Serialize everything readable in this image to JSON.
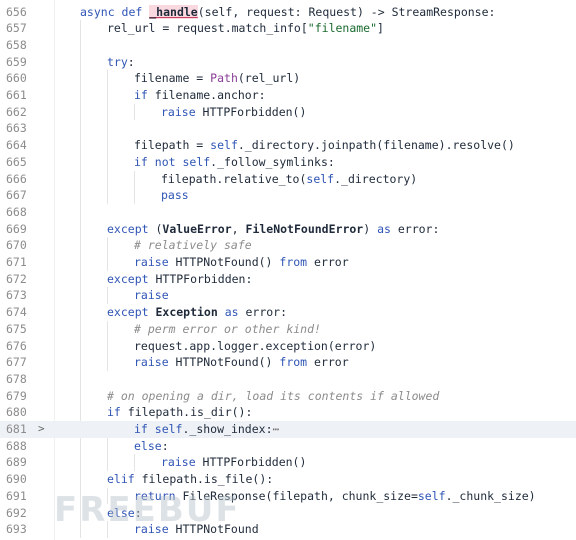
{
  "editor": {
    "current_line": 681,
    "lines": [
      {
        "n": "656",
        "fold": "",
        "indent": 1,
        "parts": [
          [
            "kw",
            "async def "
          ],
          [
            "func-hl",
            "_handle"
          ],
          [
            "par",
            "(self, request: Request) -> StreamResponse:"
          ]
        ]
      },
      {
        "n": "657",
        "fold": "",
        "indent": 2,
        "parts": [
          [
            "par",
            "rel_url = request.match_info["
          ],
          [
            "str",
            "\"filename\""
          ],
          [
            "par",
            "]"
          ]
        ]
      },
      {
        "n": "658",
        "fold": "",
        "indent": 0,
        "parts": []
      },
      {
        "n": "659",
        "fold": "",
        "indent": 2,
        "parts": [
          [
            "kw",
            "try"
          ],
          [
            "par",
            ":"
          ]
        ]
      },
      {
        "n": "660",
        "fold": "",
        "indent": 3,
        "parts": [
          [
            "par",
            "filename = "
          ],
          [
            "fn",
            "Path"
          ],
          [
            "par",
            "(rel_url)"
          ]
        ]
      },
      {
        "n": "661",
        "fold": "",
        "indent": 3,
        "parts": [
          [
            "kw",
            "if "
          ],
          [
            "par",
            "filename.anchor:"
          ]
        ]
      },
      {
        "n": "662",
        "fold": "",
        "indent": 4,
        "parts": [
          [
            "kw",
            "raise "
          ],
          [
            "par",
            "HTTPForbidden()"
          ]
        ]
      },
      {
        "n": "663",
        "fold": "",
        "indent": 0,
        "parts": []
      },
      {
        "n": "664",
        "fold": "",
        "indent": 3,
        "parts": [
          [
            "par",
            "filepath = "
          ],
          [
            "self",
            "self"
          ],
          [
            "par",
            "._directory.joinpath(filename).resolve()"
          ]
        ]
      },
      {
        "n": "665",
        "fold": "",
        "indent": 3,
        "parts": [
          [
            "kw",
            "if not "
          ],
          [
            "self",
            "self"
          ],
          [
            "par",
            "._follow_symlinks:"
          ]
        ]
      },
      {
        "n": "666",
        "fold": "",
        "indent": 4,
        "parts": [
          [
            "par",
            "filepath.relative_to("
          ],
          [
            "self",
            "self"
          ],
          [
            "par",
            "._directory)"
          ]
        ]
      },
      {
        "n": "667",
        "fold": "",
        "indent": 4,
        "parts": [
          [
            "kw",
            "pass"
          ]
        ]
      },
      {
        "n": "668",
        "fold": "",
        "indent": 0,
        "parts": []
      },
      {
        "n": "669",
        "fold": "",
        "indent": 2,
        "parts": [
          [
            "kw",
            "except "
          ],
          [
            "par",
            "("
          ],
          [
            "cls",
            "ValueError"
          ],
          [
            "par",
            ", "
          ],
          [
            "cls",
            "FileNotFoundError"
          ],
          [
            "par",
            ") "
          ],
          [
            "kw",
            "as "
          ],
          [
            "par",
            "error:"
          ]
        ]
      },
      {
        "n": "670",
        "fold": "",
        "indent": 3,
        "parts": [
          [
            "cm",
            "# relatively safe"
          ]
        ]
      },
      {
        "n": "671",
        "fold": "",
        "indent": 3,
        "parts": [
          [
            "kw",
            "raise "
          ],
          [
            "par",
            "HTTPNotFound() "
          ],
          [
            "kw",
            "from "
          ],
          [
            "par",
            "error"
          ]
        ]
      },
      {
        "n": "672",
        "fold": "",
        "indent": 2,
        "parts": [
          [
            "kw",
            "except "
          ],
          [
            "par",
            "HTTPForbidden:"
          ]
        ]
      },
      {
        "n": "673",
        "fold": "",
        "indent": 3,
        "parts": [
          [
            "kw",
            "raise"
          ]
        ]
      },
      {
        "n": "674",
        "fold": "",
        "indent": 2,
        "parts": [
          [
            "kw",
            "except "
          ],
          [
            "cls",
            "Exception"
          ],
          [
            "kw",
            " as "
          ],
          [
            "par",
            "error:"
          ]
        ]
      },
      {
        "n": "675",
        "fold": "",
        "indent": 3,
        "parts": [
          [
            "cm",
            "# perm error or other kind!"
          ]
        ]
      },
      {
        "n": "676",
        "fold": "",
        "indent": 3,
        "parts": [
          [
            "par",
            "request.app.logger.exception(error)"
          ]
        ]
      },
      {
        "n": "677",
        "fold": "",
        "indent": 3,
        "parts": [
          [
            "kw",
            "raise "
          ],
          [
            "par",
            "HTTPNotFound() "
          ],
          [
            "kw",
            "from "
          ],
          [
            "par",
            "error"
          ]
        ]
      },
      {
        "n": "678",
        "fold": "",
        "indent": 0,
        "parts": []
      },
      {
        "n": "679",
        "fold": "",
        "indent": 2,
        "parts": [
          [
            "cm",
            "# on opening a dir, load its contents if allowed"
          ]
        ]
      },
      {
        "n": "680",
        "fold": "",
        "indent": 2,
        "parts": [
          [
            "kw",
            "if "
          ],
          [
            "par",
            "filepath.is_dir():"
          ]
        ]
      },
      {
        "n": "681",
        "fold": ">",
        "indent": 3,
        "parts": [
          [
            "kw",
            "if "
          ],
          [
            "self",
            "self"
          ],
          [
            "par",
            "._show_index:"
          ],
          [
            "ell",
            "⋯"
          ]
        ]
      },
      {
        "n": "688",
        "fold": "",
        "indent": 3,
        "parts": [
          [
            "kw",
            "else"
          ],
          [
            "par",
            ":"
          ]
        ]
      },
      {
        "n": "689",
        "fold": "",
        "indent": 4,
        "parts": [
          [
            "kw",
            "raise "
          ],
          [
            "par",
            "HTTPForbidden()"
          ]
        ]
      },
      {
        "n": "690",
        "fold": "",
        "indent": 2,
        "parts": [
          [
            "kw",
            "elif "
          ],
          [
            "par",
            "filepath.is_file():"
          ]
        ]
      },
      {
        "n": "691",
        "fold": "",
        "indent": 3,
        "parts": [
          [
            "kw",
            "return "
          ],
          [
            "par",
            "FileResponse(filepath, chunk_size="
          ],
          [
            "self",
            "self"
          ],
          [
            "par",
            "._chunk_size)"
          ]
        ]
      },
      {
        "n": "692",
        "fold": "",
        "indent": 2,
        "parts": [
          [
            "kw",
            "else"
          ],
          [
            "par",
            ":"
          ]
        ]
      },
      {
        "n": "693",
        "fold": "",
        "indent": 3,
        "parts": [
          [
            "kw",
            "raise "
          ],
          [
            "par",
            "HTTPNotFound"
          ]
        ]
      }
    ]
  },
  "watermark": "FREEBUF"
}
